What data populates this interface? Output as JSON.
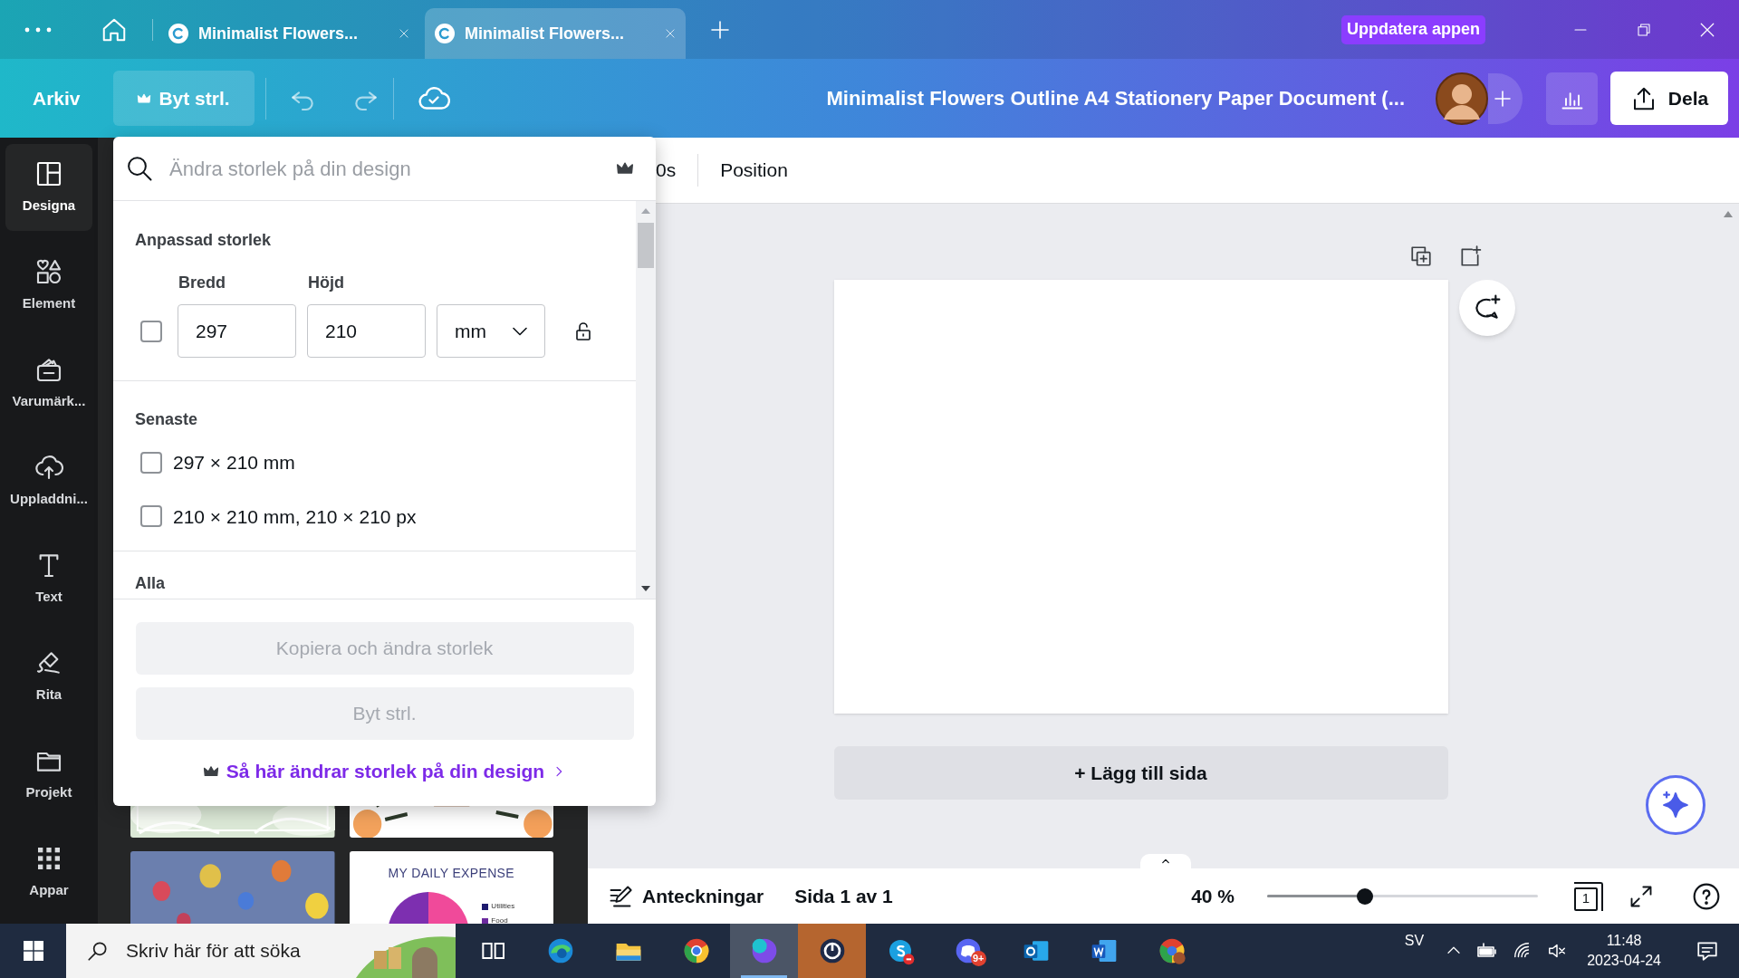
{
  "browser_tabs": [
    {
      "title": "Minimalist Flowers...",
      "selected": false
    },
    {
      "title": "Minimalist Flowers...",
      "selected": true
    }
  ],
  "update_button": "Uppdatera appen",
  "toolbar": {
    "file_menu": "Arkiv",
    "resize_button": "Byt strl.",
    "document_title": "Minimalist Flowers Outline A4 Stationery Paper Document (...",
    "share_button": "Dela"
  },
  "sidebar": [
    {
      "label": "Designa",
      "kind": "layout",
      "selected": true
    },
    {
      "label": "Element",
      "kind": "shapes",
      "selected": false
    },
    {
      "label": "Varumärk...",
      "kind": "brand",
      "selected": false
    },
    {
      "label": "Uppladdni...",
      "kind": "upload",
      "selected": false
    },
    {
      "label": "Text",
      "kind": "text",
      "selected": false
    },
    {
      "label": "Rita",
      "kind": "draw",
      "selected": false
    },
    {
      "label": "Projekt",
      "kind": "folder",
      "selected": false
    },
    {
      "label": "Appar",
      "kind": "apps",
      "selected": false
    }
  ],
  "templates": [
    {
      "kind": "picture"
    },
    {
      "kind": "picture"
    },
    {
      "kind": "picture"
    },
    {
      "kind": "expense",
      "title": "MY DAILY EXPENSE",
      "legend": [
        {
          "label": "Utilities",
          "color": "#1e1b6e"
        },
        {
          "label": "Food",
          "color": "#6b2a9e"
        }
      ]
    }
  ],
  "resize_popup": {
    "search_placeholder": "Ändra storlek på din design",
    "custom_section": "Anpassad storlek",
    "width_label": "Bredd",
    "height_label": "Höjd",
    "width_value": "297",
    "height_value": "210",
    "unit": "mm",
    "custom_checked": false,
    "recent_section": "Senaste",
    "recent": [
      {
        "label": "297 × 210 mm",
        "checked": false
      },
      {
        "label": "210 × 210 mm, 210 × 210 px",
        "checked": false
      }
    ],
    "all_section": "Alla",
    "copy_button": {
      "label": "Kopiera och ändra storlek",
      "disabled": true
    },
    "resize_button": {
      "label": "Byt strl.",
      "disabled": true
    },
    "help_link": "Så här ändrar storlek på din design"
  },
  "canvas_toolbar": [
    "0s",
    "Position"
  ],
  "add_page_button": "+ Lägg till sida",
  "bottom_bar": {
    "notes": "Anteckningar",
    "page_info": "Sida 1 av 1",
    "zoom": "40 %",
    "zoom_slider": {
      "level": 0.36
    },
    "page_count": "1"
  },
  "taskbar": {
    "search_placeholder": "Skriv här för att söka",
    "apps": [
      {
        "kind": "taskview",
        "selected": false,
        "flashing": false
      },
      {
        "kind": "edge",
        "selected": false,
        "flashing": false
      },
      {
        "kind": "explorer",
        "selected": false,
        "flashing": false
      },
      {
        "kind": "chrome",
        "selected": false,
        "flashing": false
      },
      {
        "kind": "canva",
        "selected": true,
        "flashing": false
      },
      {
        "kind": "timer",
        "selected": false,
        "flashing": true
      },
      {
        "kind": "skype",
        "selected": false,
        "flashing": false
      },
      {
        "kind": "discord",
        "selected": false,
        "flashing": false,
        "badge": "9+"
      },
      {
        "kind": "outlook",
        "selected": false,
        "flashing": false
      },
      {
        "kind": "word",
        "selected": false,
        "flashing": false
      },
      {
        "kind": "chrome-profile",
        "selected": false,
        "flashing": false
      }
    ],
    "language": "SV",
    "time": "11:48",
    "date": "2023-04-24"
  }
}
